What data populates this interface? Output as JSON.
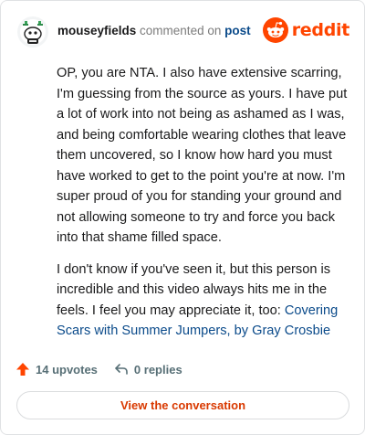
{
  "header": {
    "username": "mouseyfields",
    "action": "commented on",
    "target": "post",
    "brand": "reddit",
    "icons": {
      "avatar": "snoo-avatar",
      "brand": "reddit-snoo-icon"
    },
    "colors": {
      "brand": "#ff4500",
      "link": "#0a4a8a"
    }
  },
  "comment": {
    "paragraph1": "OP, you are NTA. I also have extensive scarring, I'm guessing from the source as yours. I have put a lot of work into not being as ashamed as I was, and being comfortable wearing clothes that leave them uncovered, so I know how hard you must have worked to get to the point you're at now. I'm super proud of you for standing your ground and not allowing someone to try and force you back into that shame filled space.",
    "paragraph2_prefix": "I don't know if you've seen it, but this person is incredible and this video always hits me in the feels. I feel you may appreciate it, too: ",
    "link_text": "Covering Scars with Summer Jumpers, by Gray Crosbie"
  },
  "footer": {
    "upvotes": "14 upvotes",
    "replies": "0 replies",
    "icons": {
      "upvotes": "upvote-arrow-icon",
      "replies": "reply-arrow-icon"
    }
  },
  "cta": {
    "label": "View the conversation"
  }
}
